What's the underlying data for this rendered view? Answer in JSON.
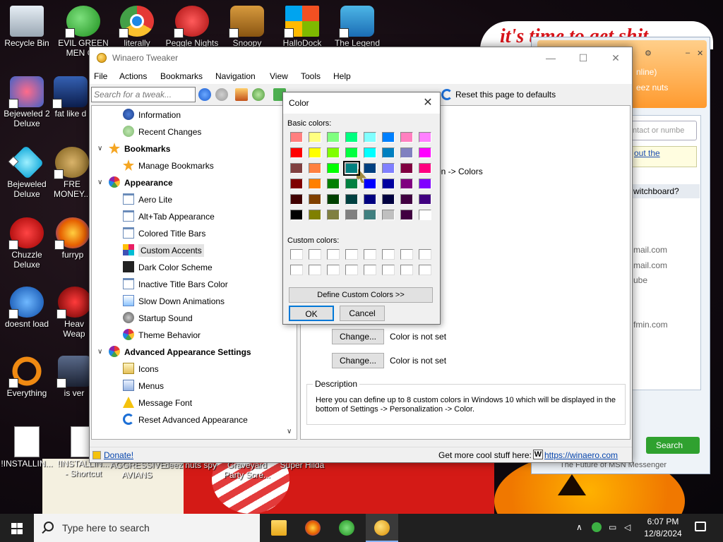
{
  "desktop": {
    "icons": [
      {
        "label": "Recycle Bin",
        "icon": "recycle-bin-icon"
      },
      {
        "label": "EVIL GREEN MEN C...",
        "icon": "msn-icon"
      },
      {
        "label": "literally",
        "icon": "chrome-icon"
      },
      {
        "label": "Peggle Nights",
        "icon": "peggle-icon"
      },
      {
        "label": "Snoopy",
        "icon": "snoopy-icon"
      },
      {
        "label": "HalloDock",
        "icon": "windows-shield-icon"
      },
      {
        "label": "The Legend",
        "icon": "legend-icon"
      },
      {
        "label": "Bejeweled 2 Deluxe",
        "icon": "bejeweled2-icon"
      },
      {
        "label": "fat like d",
        "icon": "mask-icon"
      },
      {
        "label": "Bejeweled Deluxe",
        "icon": "bejeweled-icon"
      },
      {
        "label": "FRE MONEY...",
        "icon": "money-icon"
      },
      {
        "label": "Chuzzle Deluxe",
        "icon": "chuzzle-icon"
      },
      {
        "label": "furryp",
        "icon": "firefox-icon"
      },
      {
        "label": "doesnt load",
        "icon": "thunderbird-icon"
      },
      {
        "label": "Heav Weap",
        "icon": "heavy-weapon-icon"
      },
      {
        "label": "Everything",
        "icon": "everything-icon"
      },
      {
        "label": "is ver",
        "icon": "mw-icon"
      },
      {
        "label": "!INSTALLIN...",
        "icon": "document-icon"
      },
      {
        "label": "!INSTALLIN... - Shortcut",
        "icon": "document-icon"
      },
      {
        "label": "AGGRESSIVE AVIANS",
        "icon": "game-icon"
      },
      {
        "label": "deez nuts spy",
        "icon": "game-icon"
      },
      {
        "label": "Graveyard Party Scre...",
        "icon": "game-icon"
      },
      {
        "label": "Super Hilda",
        "icon": "game-icon"
      }
    ],
    "wallpaper_text": "it's time to get shit"
  },
  "msn": {
    "status_line": "nline)",
    "personal_msg": "eez nuts",
    "search_placeholder": "ntact or numbe",
    "ad_link": "out the",
    "section": "witchboard?",
    "contacts": [
      "mail.com",
      "mail.com",
      "ube",
      "fmin.com"
    ],
    "search_button": "Search",
    "footer": "The Future of MSN Messenger"
  },
  "winaero": {
    "title": "Winaero Tweaker",
    "menu": [
      "File",
      "Actions",
      "Bookmarks",
      "Navigation",
      "View",
      "Tools",
      "Help"
    ],
    "search_placeholder": "Search for a tweak...",
    "reset_label": "Reset this page to defaults",
    "tree": [
      {
        "label": "Information",
        "icon": "info-icon",
        "level": "child"
      },
      {
        "label": "Recent Changes",
        "icon": "recent-changes-icon",
        "level": "child"
      },
      {
        "label": "Bookmarks",
        "icon": "star-icon",
        "level": "category"
      },
      {
        "label": "Manage Bookmarks",
        "icon": "star-icon",
        "level": "child"
      },
      {
        "label": "Appearance",
        "icon": "palette-icon",
        "level": "category"
      },
      {
        "label": "Aero Lite",
        "icon": "window-icon",
        "level": "child"
      },
      {
        "label": "Alt+Tab Appearance",
        "icon": "window-icon",
        "level": "child"
      },
      {
        "label": "Colored Title Bars",
        "icon": "window-icon",
        "level": "child"
      },
      {
        "label": "Custom Accents",
        "icon": "accent-icon",
        "level": "child",
        "selected": true
      },
      {
        "label": "Dark Color Scheme",
        "icon": "dark-icon",
        "level": "child"
      },
      {
        "label": "Inactive Title Bars Color",
        "icon": "window-icon",
        "level": "child"
      },
      {
        "label": "Slow Down Animations",
        "icon": "animation-icon",
        "level": "child"
      },
      {
        "label": "Startup Sound",
        "icon": "sound-icon",
        "level": "child"
      },
      {
        "label": "Theme Behavior",
        "icon": "palette-icon",
        "level": "child"
      },
      {
        "label": "Advanced Appearance Settings",
        "icon": "palette-icon",
        "level": "category"
      },
      {
        "label": "Icons",
        "icon": "icons-icon",
        "level": "child"
      },
      {
        "label": "Menus",
        "icon": "menus-icon",
        "level": "child"
      },
      {
        "label": "Message Font",
        "icon": "warning-icon",
        "level": "child"
      },
      {
        "label": "Reset Advanced Appearance",
        "icon": "reset-icon",
        "level": "child"
      }
    ],
    "content": {
      "path_text": "on -> Colors",
      "change_button": "Change...",
      "not_set": "Color is not set",
      "description_title": "Description",
      "description": "Here you can define up to 8 custom colors in Windows 10 which will be displayed in the bottom of Settings -> Personalization -> Color."
    },
    "status": {
      "donate": "Donate!",
      "more": "Get more cool stuff here:",
      "site_icon": "W",
      "site": "https://winaero.com"
    }
  },
  "color_dialog": {
    "title": "Color",
    "close": "✕",
    "basic_label": "Basic colors:",
    "custom_label": "Custom colors:",
    "define_button": "Define Custom Colors >>",
    "ok": "OK",
    "cancel": "Cancel",
    "basic_colors": [
      "#ff8080",
      "#ffff80",
      "#80ff80",
      "#00ff80",
      "#80ffff",
      "#0080ff",
      "#ff80c0",
      "#ff80ff",
      "#ff0000",
      "#ffff00",
      "#80ff00",
      "#00ff40",
      "#00ffff",
      "#0080c0",
      "#8080c0",
      "#ff00ff",
      "#804040",
      "#ff8040",
      "#00ff00",
      "#008080",
      "#004080",
      "#8080ff",
      "#800040",
      "#ff0080",
      "#800000",
      "#ff8000",
      "#008000",
      "#008040",
      "#0000ff",
      "#0000a0",
      "#800080",
      "#8000ff",
      "#400000",
      "#804000",
      "#004000",
      "#004040",
      "#000080",
      "#000040",
      "#400040",
      "#400080",
      "#000000",
      "#808000",
      "#808040",
      "#808080",
      "#408080",
      "#c0c0c0",
      "#400040",
      "#ffffff"
    ],
    "selected_index": 19,
    "custom_count": 16
  },
  "taskbar": {
    "search_placeholder": "Type here to search",
    "apps": [
      "file-explorer-icon",
      "firefox-icon",
      "msn-icon",
      "winaero-icon"
    ],
    "time": "6:07 PM",
    "date": "12/8/2024"
  }
}
